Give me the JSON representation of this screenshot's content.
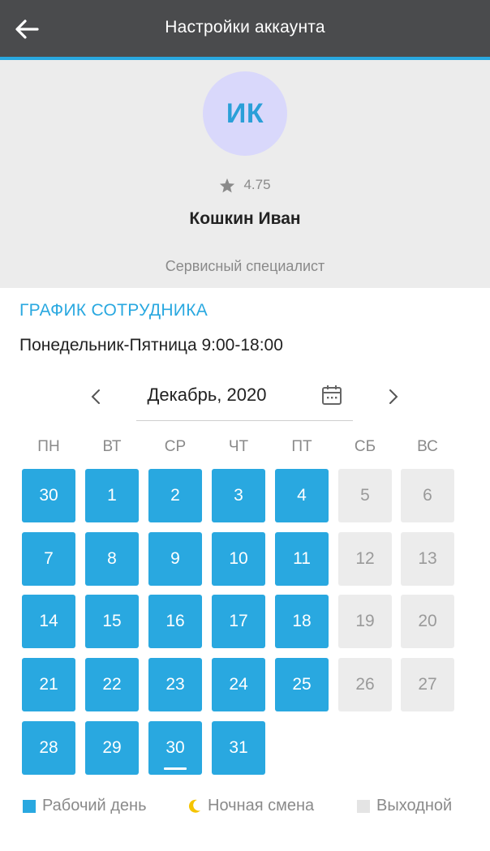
{
  "header": {
    "title": "Настройки аккаунта",
    "back_icon": "arrow-left-icon",
    "background": "#4a4b4d",
    "accent": "#29a8e0"
  },
  "profile": {
    "initials": "ИК",
    "rating": "4.75",
    "name": "Кошкин Иван",
    "role": "Сервисный специалист",
    "avatar_color": "#d9d8fb"
  },
  "schedule": {
    "title": "ГРАФИК СОТРУДНИКА",
    "text": "Понедельник-Пятница 9:00-18:00"
  },
  "calendar": {
    "month_label": "Декабрь, 2020",
    "weekdays": [
      "ПН",
      "ВТ",
      "СР",
      "ЧТ",
      "ПТ",
      "СБ",
      "ВС"
    ],
    "weeks": [
      [
        {
          "d": "30",
          "t": "work"
        },
        {
          "d": "1",
          "t": "work"
        },
        {
          "d": "2",
          "t": "work"
        },
        {
          "d": "3",
          "t": "work"
        },
        {
          "d": "4",
          "t": "work"
        },
        {
          "d": "5",
          "t": "off"
        },
        {
          "d": "6",
          "t": "off"
        }
      ],
      [
        {
          "d": "7",
          "t": "work"
        },
        {
          "d": "8",
          "t": "work"
        },
        {
          "d": "9",
          "t": "work"
        },
        {
          "d": "10",
          "t": "work"
        },
        {
          "d": "11",
          "t": "work"
        },
        {
          "d": "12",
          "t": "off"
        },
        {
          "d": "13",
          "t": "off"
        }
      ],
      [
        {
          "d": "14",
          "t": "work"
        },
        {
          "d": "15",
          "t": "work"
        },
        {
          "d": "16",
          "t": "work"
        },
        {
          "d": "17",
          "t": "work"
        },
        {
          "d": "18",
          "t": "work"
        },
        {
          "d": "19",
          "t": "off"
        },
        {
          "d": "20",
          "t": "off"
        }
      ],
      [
        {
          "d": "21",
          "t": "work"
        },
        {
          "d": "22",
          "t": "work"
        },
        {
          "d": "23",
          "t": "work"
        },
        {
          "d": "24",
          "t": "work"
        },
        {
          "d": "25",
          "t": "work"
        },
        {
          "d": "26",
          "t": "off"
        },
        {
          "d": "27",
          "t": "off"
        }
      ],
      [
        {
          "d": "28",
          "t": "work"
        },
        {
          "d": "29",
          "t": "work"
        },
        {
          "d": "30",
          "t": "work",
          "today": true
        },
        {
          "d": "31",
          "t": "work"
        }
      ]
    ],
    "work_color": "#29a8e0",
    "off_color": "#ececec"
  },
  "legend": {
    "work": "Рабочий день",
    "night": "Ночная смена",
    "off": "Выходной",
    "night_color": "#f5c400"
  }
}
